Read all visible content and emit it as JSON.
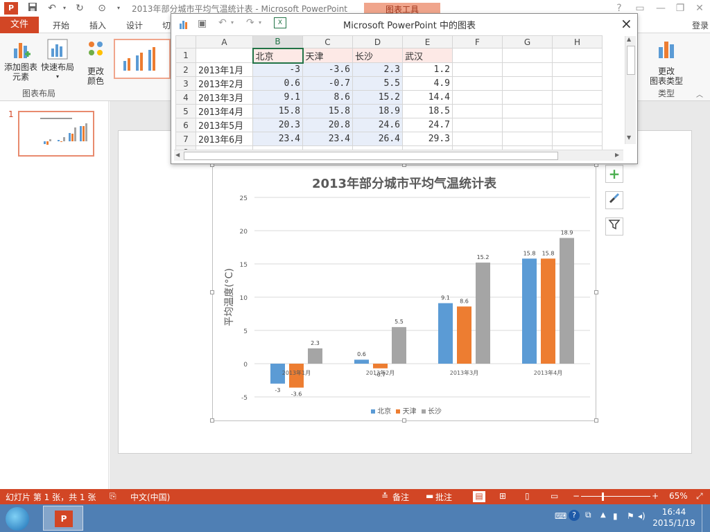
{
  "app": {
    "window_title": "2013年部分城市平均气温统计表 - Microsoft PowerPoint",
    "context_tab_group": "图表工具",
    "login_label": "登录"
  },
  "quick_access": {
    "icons": [
      "powerpoint-icon",
      "save-icon",
      "undo-icon",
      "redo-icon",
      "slideshow-icon",
      "customize-icon"
    ]
  },
  "tabs": [
    "文件",
    "开始",
    "插入",
    "设计",
    "切"
  ],
  "ribbon": {
    "add_element": "添加图表\n元素",
    "add_element_line1": "添加图表",
    "add_element_line2": "元素",
    "quick_layout_line1": "快速布局",
    "change_color_line1": "更改",
    "change_color_line2": "颜色",
    "group_layout": "图表布局",
    "change_type_line1": "更改",
    "change_type_line2": "图表类型",
    "group_type": "类型"
  },
  "slides_panel": {
    "slide_number": "1"
  },
  "datasheet": {
    "title": "Microsoft PowerPoint 中的图表",
    "close": "×",
    "col_headers": [
      "A",
      "B",
      "C",
      "D",
      "E",
      "F",
      "G",
      "H"
    ],
    "rows": [
      {
        "n": "1",
        "cells": [
          "",
          "北京",
          "天津",
          "长沙",
          "武汉"
        ]
      },
      {
        "n": "2",
        "cells": [
          "2013年1月",
          "-3",
          "-3.6",
          "2.3",
          "1.2"
        ]
      },
      {
        "n": "3",
        "cells": [
          "2013年2月",
          "0.6",
          "-0.7",
          "5.5",
          "4.9"
        ]
      },
      {
        "n": "4",
        "cells": [
          "2013年3月",
          "9.1",
          "8.6",
          "15.2",
          "14.4"
        ]
      },
      {
        "n": "5",
        "cells": [
          "2013年4月",
          "15.8",
          "15.8",
          "18.9",
          "18.5"
        ]
      },
      {
        "n": "6",
        "cells": [
          "2013年5月",
          "20.3",
          "20.8",
          "24.6",
          "24.7"
        ]
      },
      {
        "n": "7",
        "cells": [
          "2013年6月",
          "23.4",
          "23.4",
          "26.4",
          "29.3"
        ]
      },
      {
        "n": "8",
        "cells": [
          "",
          "",
          "",
          "",
          ""
        ]
      }
    ]
  },
  "chart_data": {
    "type": "bar",
    "title": "2013年部分城市平均气温统计表",
    "ylabel": "平均温度(°C)",
    "xlabel": "",
    "categories": [
      "2013年1月",
      "2013年2月",
      "2013年3月",
      "2013年4月"
    ],
    "series": [
      {
        "name": "北京",
        "color": "#5b9bd5",
        "values": [
          -3,
          0.6,
          9.1,
          15.8
        ]
      },
      {
        "name": "天津",
        "color": "#ed7d31",
        "values": [
          -3.6,
          -0.7,
          8.6,
          15.8
        ]
      },
      {
        "name": "长沙",
        "color": "#a5a5a5",
        "values": [
          2.3,
          5.5,
          15.2,
          18.9
        ]
      }
    ],
    "data_labels": [
      [
        "-3",
        "0.6",
        "9.1",
        "15.8"
      ],
      [
        "-3.6",
        "-0.7",
        "8.6",
        "15.8"
      ],
      [
        "2.3",
        "5.5",
        "15.2",
        "18.9"
      ]
    ],
    "yticks": [
      "-5",
      "0",
      "5",
      "10",
      "15",
      "20",
      "25"
    ],
    "ylim": [
      -5,
      25
    ],
    "grid": true,
    "legend": "bottom"
  },
  "side_buttons": [
    "add-element-icon",
    "brush-icon",
    "filter-icon"
  ],
  "statusbar": {
    "slide_info": "幻灯片 第 1 张，共 1 张",
    "language": "中文(中国)",
    "notes": "备注",
    "comments": "批注",
    "zoom": "65%"
  },
  "taskbar": {
    "time": "16:44",
    "date": "2015/1/19"
  },
  "colors": {
    "accent": "#d24625",
    "taskbar": "#4f7fb4"
  }
}
